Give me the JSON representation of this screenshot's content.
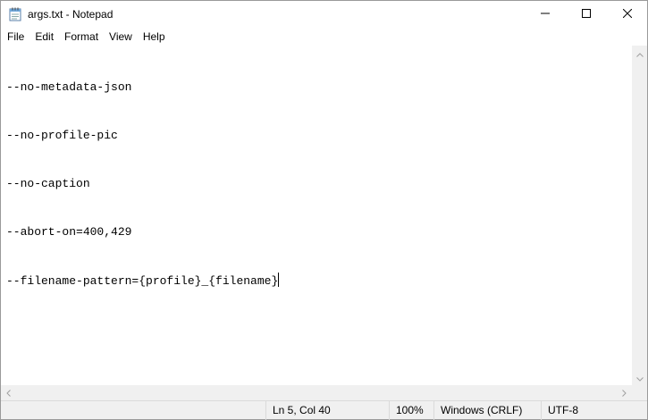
{
  "window": {
    "title": "args.txt - Notepad"
  },
  "icons": {
    "app": "notepad-icon",
    "minimize": "minimize-icon",
    "maximize": "maximize-icon",
    "close": "close-icon"
  },
  "menu": {
    "items": [
      "File",
      "Edit",
      "Format",
      "View",
      "Help"
    ]
  },
  "editor": {
    "lines": [
      "--no-metadata-json",
      "--no-profile-pic",
      "--no-caption",
      "--abort-on=400,429",
      "--filename-pattern={profile}_{filename}"
    ]
  },
  "status": {
    "position": "Ln 5, Col 40",
    "zoom": "100%",
    "line_ending": "Windows (CRLF)",
    "encoding": "UTF-8"
  }
}
